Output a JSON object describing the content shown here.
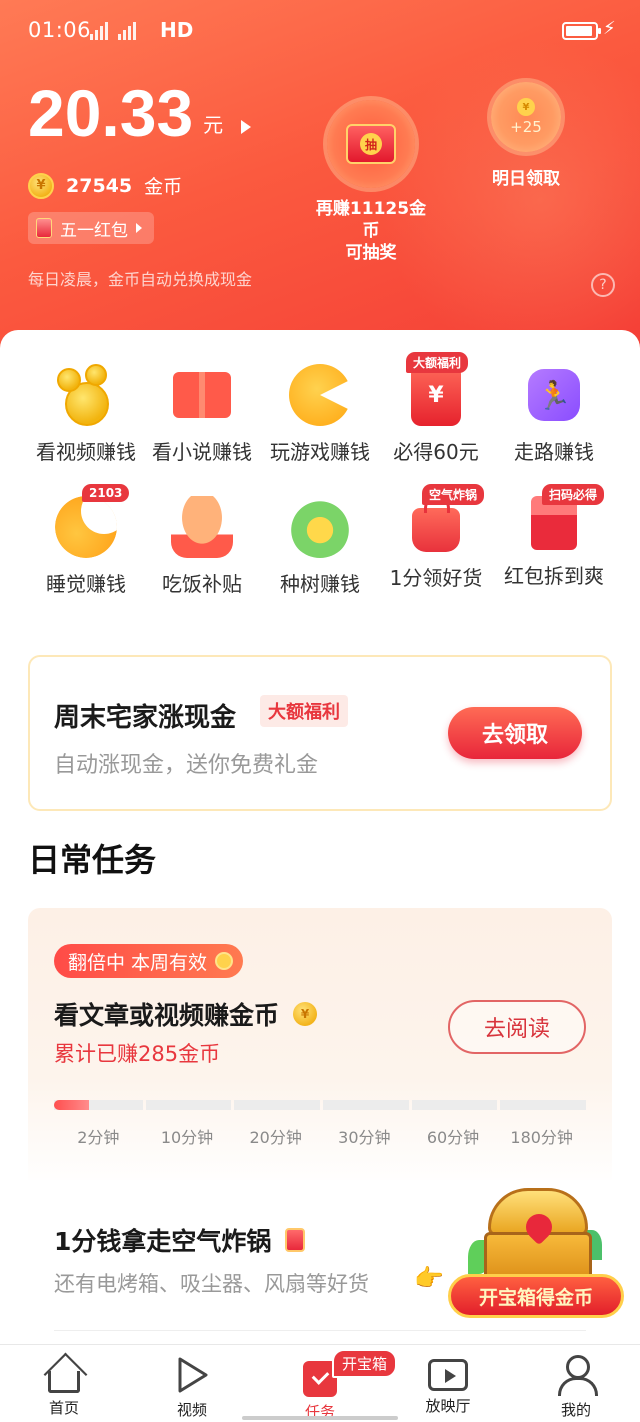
{
  "status_bar": {
    "time": "01:06",
    "network": "HD",
    "signal_label": "4G"
  },
  "header": {
    "balance": "20.33",
    "balance_unit": "元",
    "coin_count": "27545",
    "coin_label": "金币",
    "promo_pill": "五一红包",
    "hint": "每日凌晨，金币自动兑换成现金",
    "help": "?",
    "lottery_icon_text": "抽",
    "lottery_line1": "再赚11125金币",
    "lottery_line2": "可抽奖",
    "tomorrow_reward": "+25",
    "tomorrow_label": "明日领取"
  },
  "earn_grid": [
    {
      "label": "看视频赚钱",
      "icon": "gold-coins-icon"
    },
    {
      "label": "看小说赚钱",
      "icon": "book-icon"
    },
    {
      "label": "玩游戏赚钱",
      "icon": "pacman-icon"
    },
    {
      "label": "必得60元",
      "icon": "red-envelope-icon",
      "badge": "大额福利",
      "icon_text": "¥"
    },
    {
      "label": "走路赚钱",
      "icon": "walking-icon"
    },
    {
      "label": "睡觉赚钱",
      "icon": "moon-icon",
      "badge": "2103"
    },
    {
      "label": "吃饭补贴",
      "icon": "roast-chicken-icon"
    },
    {
      "label": "种树赚钱",
      "icon": "tree-icon"
    },
    {
      "label": "1分领好货",
      "icon": "shopping-bag-icon",
      "badge": "空气炸锅"
    },
    {
      "label": "红包拆到爽",
      "icon": "envelope-icon",
      "badge": "扫码必得"
    }
  ],
  "promo_card": {
    "title": "周末宅家涨现金",
    "tag": "大额福利",
    "subtitle": "自动涨现金，送你免费礼金",
    "button": "去领取"
  },
  "daily_title": "日常任务",
  "reading_task": {
    "double_badge": "翻倍中 本周有效",
    "title": "看文章或视频赚金币",
    "earned": "累计已赚285金币",
    "button": "去阅读",
    "progress_fraction": 0.065,
    "milestones": [
      "2分钟",
      "10分钟",
      "20分钟",
      "30分钟",
      "60分钟",
      "180分钟"
    ]
  },
  "airfryer_task": {
    "title": "1分钱拿走空气炸锅",
    "subtitle": "还有电烤箱、吸尘器、风扇等好货",
    "chest_button": "开宝箱得金币"
  },
  "tabbar": {
    "items": [
      {
        "label": "首页",
        "icon": "home-icon"
      },
      {
        "label": "视频",
        "icon": "play-icon"
      },
      {
        "label": "任务",
        "icon": "task-icon",
        "bubble": "开宝箱",
        "active": true
      },
      {
        "label": "放映厅",
        "icon": "cinema-icon"
      },
      {
        "label": "我的",
        "icon": "profile-icon"
      }
    ]
  },
  "colors": {
    "accent": "#e8373e",
    "header_start": "#ff7a55",
    "header_end": "#f43e36",
    "coin": "#f3b41c"
  }
}
